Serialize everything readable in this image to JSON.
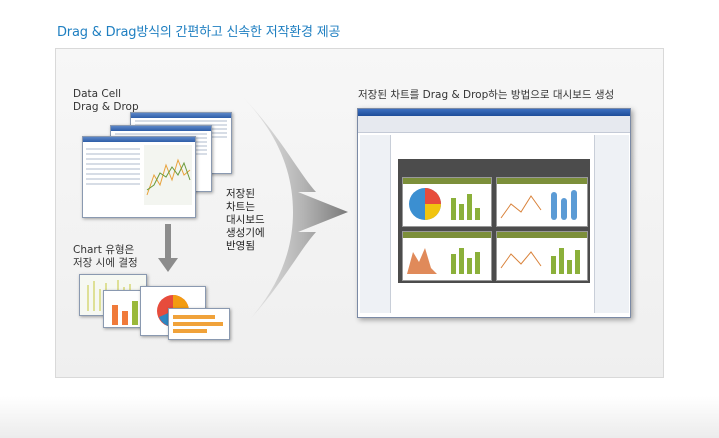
{
  "page": {
    "title": "Drag & Drag방식의 간편하고 신속한 저작환경 제공"
  },
  "left": {
    "data_cell_label": "Data Cell\nDrag & Drop",
    "chart_label": "Chart 유형은\n저장 시에 결정"
  },
  "middle": {
    "reflect_label": "저장된\n차트는\n대시보드\n생성기에\n반영됨"
  },
  "right": {
    "caption": "저장된 차트를 Drag & Drop하는 방법으로 대시보드 생성"
  },
  "colors": {
    "title": "#1f7fc1",
    "accent_green": "#7c8f3a",
    "window_blue": "#2f5ea8"
  }
}
